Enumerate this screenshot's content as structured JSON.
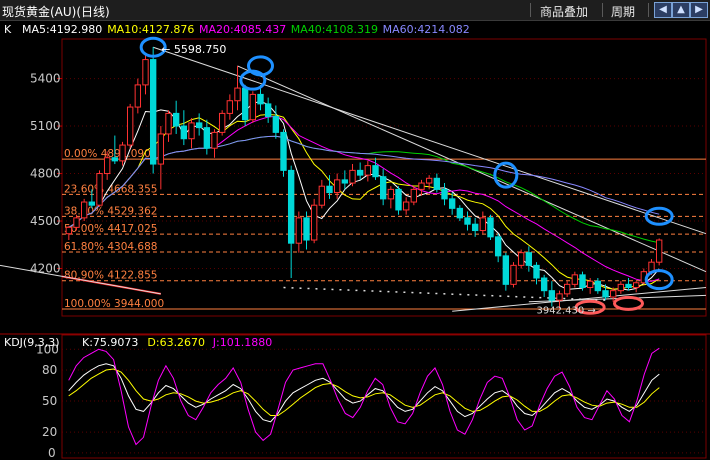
{
  "toolbar": {
    "title": "现货黄金(AU)(日线)",
    "overlay_label": "商品叠加",
    "period_label": "周期",
    "icons": [
      "arrow-left-icon",
      "arrow-up-icon",
      "arrow-down-icon",
      "arrow-right-icon"
    ]
  },
  "chart_data": [
    {
      "type": "candlestick",
      "title": "K",
      "ma_labels": [
        {
          "text": "MA5:4192.980",
          "color": "#ffffff"
        },
        {
          "text": "MA10:4127.876",
          "color": "#ffff00"
        },
        {
          "text": "MA20:4085.437",
          "color": "#ff00ff"
        },
        {
          "text": "MA40:4108.319",
          "color": "#00d000"
        },
        {
          "text": "MA60:4214.082",
          "color": "#8888ff"
        }
      ],
      "y_ticks": [
        5400,
        5100,
        4800,
        4500,
        4200
      ],
      "ylim": [
        3900,
        5650
      ],
      "high_label": "5598.750",
      "low_label": "3942.430",
      "fibonacci": [
        {
          "level": "0.00%",
          "value": 4891.09,
          "label": "0.00% 4891.090"
        },
        {
          "level": "23.60%",
          "value": 4668.355,
          "label": "23.60% 4668.355"
        },
        {
          "level": "38.20%",
          "value": 4529.362,
          "label": "38.20% 4529.362"
        },
        {
          "level": "50.00%",
          "value": 4417.025,
          "label": "50.00% 4417.025"
        },
        {
          "level": "61.80%",
          "value": 4304.688,
          "label": "61.80% 4304.688"
        },
        {
          "level": "80.90%",
          "value": 4122.855,
          "label": "80.90% 4122.855"
        },
        {
          "level": "100.00%",
          "value": 3944.0,
          "label": "100.00% 3944.000"
        }
      ],
      "colors": {
        "up": "#ff3232",
        "down": "#00d8d8",
        "fib": "#ff8040",
        "trend": "#dcdcdc",
        "marker_blue": "#1e90ff",
        "marker_red": "#ff5a5a"
      },
      "candles": [
        [
          4420,
          4470,
          4380,
          4460
        ],
        [
          4460,
          4540,
          4440,
          4520
        ],
        [
          4520,
          4640,
          4500,
          4620
        ],
        [
          4620,
          4700,
          4580,
          4600
        ],
        [
          4600,
          4820,
          4590,
          4800
        ],
        [
          4800,
          4940,
          4760,
          4900
        ],
        [
          4900,
          5040,
          4860,
          4880
        ],
        [
          4880,
          5000,
          4850,
          4980
        ],
        [
          4980,
          5240,
          4960,
          5220
        ],
        [
          5220,
          5400,
          5180,
          5360
        ],
        [
          5360,
          5560,
          5300,
          5520
        ],
        [
          5520,
          5600,
          4800,
          4860
        ],
        [
          4860,
          5100,
          4700,
          5050
        ],
        [
          5050,
          5200,
          5000,
          5180
        ],
        [
          5180,
          5260,
          5050,
          5100
        ],
        [
          5100,
          5200,
          4980,
          5020
        ],
        [
          5020,
          5150,
          4960,
          5120
        ],
        [
          5120,
          5180,
          5040,
          5090
        ],
        [
          5090,
          5140,
          4920,
          4960
        ],
        [
          4960,
          5080,
          4900,
          5060
        ],
        [
          5060,
          5200,
          5040,
          5180
        ],
        [
          5180,
          5300,
          5140,
          5260
        ],
        [
          5260,
          5480,
          5200,
          5340
        ],
        [
          5340,
          5360,
          5100,
          5140
        ],
        [
          5140,
          5320,
          5120,
          5300
        ],
        [
          5300,
          5360,
          5200,
          5240
        ],
        [
          5240,
          5280,
          5120,
          5160
        ],
        [
          5160,
          5230,
          5020,
          5060
        ],
        [
          5060,
          5080,
          4780,
          4820
        ],
        [
          4820,
          4850,
          4140,
          4360
        ],
        [
          4360,
          4560,
          4300,
          4520
        ],
        [
          4520,
          4560,
          4320,
          4380
        ],
        [
          4380,
          4640,
          4360,
          4600
        ],
        [
          4600,
          4760,
          4580,
          4720
        ],
        [
          4720,
          4790,
          4640,
          4680
        ],
        [
          4680,
          4800,
          4640,
          4760
        ],
        [
          4760,
          4820,
          4700,
          4740
        ],
        [
          4740,
          4860,
          4720,
          4820
        ],
        [
          4820,
          4870,
          4760,
          4790
        ],
        [
          4790,
          4880,
          4750,
          4850
        ],
        [
          4850,
          4900,
          4760,
          4780
        ],
        [
          4780,
          4830,
          4600,
          4640
        ],
        [
          4640,
          4720,
          4580,
          4700
        ],
        [
          4700,
          4720,
          4540,
          4570
        ],
        [
          4570,
          4650,
          4540,
          4620
        ],
        [
          4620,
          4720,
          4600,
          4700
        ],
        [
          4700,
          4760,
          4660,
          4740
        ],
        [
          4740,
          4790,
          4700,
          4770
        ],
        [
          4770,
          4800,
          4680,
          4700
        ],
        [
          4700,
          4740,
          4600,
          4640
        ],
        [
          4640,
          4680,
          4540,
          4580
        ],
        [
          4580,
          4600,
          4500,
          4520
        ],
        [
          4520,
          4560,
          4440,
          4480
        ],
        [
          4480,
          4520,
          4400,
          4440
        ],
        [
          4440,
          4560,
          4420,
          4520
        ],
        [
          4520,
          4540,
          4380,
          4400
        ],
        [
          4400,
          4420,
          4240,
          4280
        ],
        [
          4280,
          4300,
          4060,
          4100
        ],
        [
          4100,
          4240,
          4080,
          4220
        ],
        [
          4220,
          4320,
          4200,
          4300
        ],
        [
          4300,
          4340,
          4180,
          4220
        ],
        [
          4220,
          4240,
          4100,
          4140
        ],
        [
          4140,
          4160,
          4020,
          4060
        ],
        [
          4060,
          4120,
          3960,
          4000
        ],
        [
          4000,
          4060,
          3942,
          4040
        ],
        [
          4040,
          4120,
          4020,
          4100
        ],
        [
          4100,
          4180,
          4080,
          4160
        ],
        [
          4160,
          4180,
          4060,
          4080
        ],
        [
          4080,
          4140,
          4040,
          4120
        ],
        [
          4120,
          4140,
          4040,
          4060
        ],
        [
          4060,
          4100,
          4000,
          4020
        ],
        [
          4020,
          4080,
          3990,
          4060
        ],
        [
          4060,
          4120,
          4040,
          4100
        ],
        [
          4100,
          4140,
          4060,
          4080
        ],
        [
          4080,
          4120,
          4050,
          4110
        ],
        [
          4110,
          4200,
          4100,
          4180
        ],
        [
          4180,
          4260,
          4160,
          4240
        ],
        [
          4240,
          4390,
          4220,
          4380
        ]
      ]
    },
    {
      "type": "line",
      "title": "KDJ(9,3,3)",
      "labels": [
        {
          "text": "K:75.9073",
          "color": "#ffffff"
        },
        {
          "text": "D:63.2670",
          "color": "#ffff00"
        },
        {
          "text": "J:101.1880",
          "color": "#ff00ff"
        }
      ],
      "y_ticks": [
        100,
        80,
        50,
        20,
        0
      ],
      "ylim": [
        -5,
        108
      ],
      "series": [
        {
          "name": "K",
          "color": "#ffffff",
          "values": [
            60,
            68,
            75,
            80,
            84,
            86,
            84,
            72,
            55,
            42,
            40,
            48,
            58,
            65,
            62,
            55,
            48,
            44,
            47,
            52,
            56,
            60,
            66,
            62,
            52,
            40,
            32,
            30,
            38,
            50,
            58,
            62,
            66,
            70,
            72,
            68,
            60,
            52,
            48,
            50,
            56,
            62,
            60,
            52,
            44,
            40,
            42,
            50,
            58,
            64,
            60,
            50,
            40,
            35,
            38,
            45,
            52,
            58,
            60,
            55,
            45,
            38,
            36,
            42,
            50,
            58,
            62,
            58,
            50,
            44,
            42,
            46,
            52,
            50,
            44,
            40,
            46,
            58,
            70,
            76
          ]
        },
        {
          "name": "D",
          "color": "#ffff00",
          "values": [
            55,
            60,
            66,
            72,
            76,
            80,
            81,
            78,
            70,
            60,
            52,
            50,
            52,
            56,
            58,
            57,
            54,
            50,
            48,
            49,
            51,
            54,
            58,
            60,
            57,
            50,
            42,
            36,
            36,
            41,
            47,
            53,
            58,
            63,
            66,
            67,
            64,
            59,
            55,
            53,
            54,
            57,
            58,
            56,
            51,
            46,
            44,
            46,
            51,
            56,
            58,
            55,
            49,
            43,
            40,
            41,
            45,
            50,
            54,
            55,
            51,
            45,
            40,
            40,
            44,
            50,
            55,
            56,
            53,
            49,
            46,
            45,
            48,
            49,
            47,
            44,
            44,
            49,
            57,
            63
          ]
        },
        {
          "name": "J",
          "color": "#ff00ff",
          "values": [
            70,
            84,
            92,
            96,
            100,
            98,
            90,
            60,
            25,
            8,
            15,
            45,
            70,
            84,
            72,
            50,
            36,
            32,
            44,
            58,
            66,
            72,
            82,
            68,
            42,
            20,
            12,
            18,
            42,
            68,
            80,
            82,
            84,
            86,
            86,
            70,
            52,
            38,
            34,
            44,
            60,
            72,
            66,
            44,
            30,
            28,
            38,
            58,
            74,
            82,
            66,
            40,
            22,
            18,
            32,
            52,
            68,
            74,
            72,
            54,
            32,
            22,
            26,
            46,
            62,
            74,
            78,
            64,
            44,
            34,
            32,
            46,
            60,
            52,
            36,
            30,
            50,
            76,
            96,
            101
          ]
        }
      ]
    }
  ]
}
